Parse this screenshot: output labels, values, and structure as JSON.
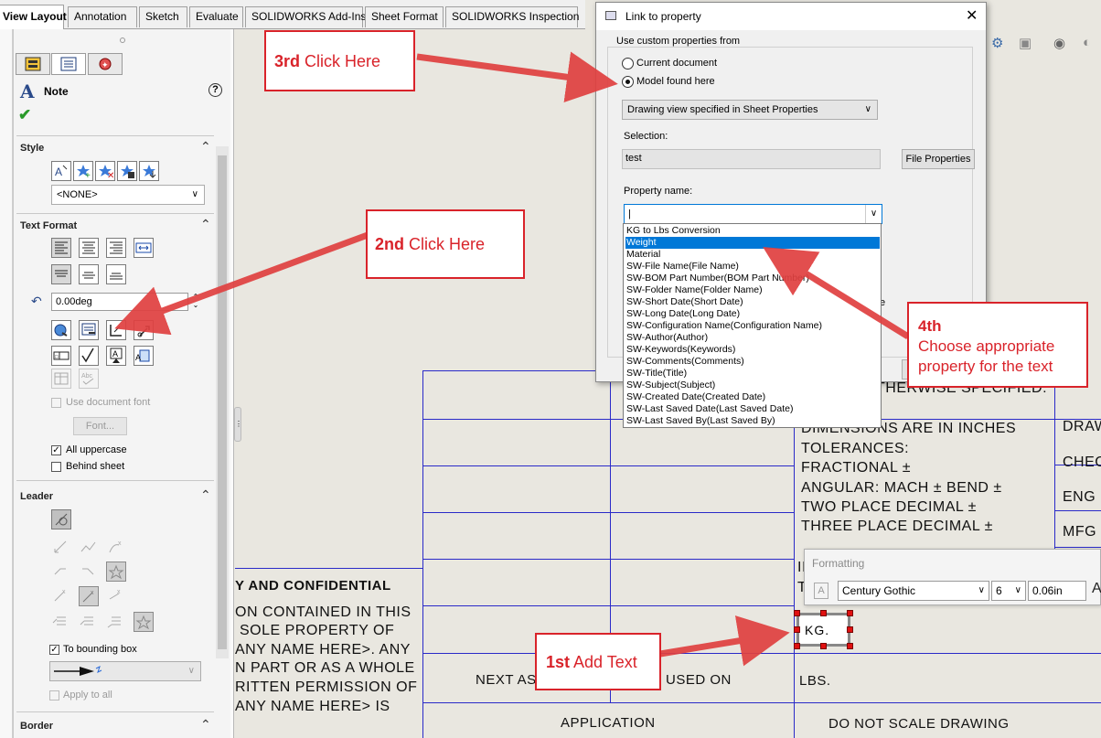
{
  "tabs": [
    "View Layout",
    "Annotation",
    "Sketch",
    "Evaluate",
    "SOLIDWORKS Add-Ins",
    "Sheet Format",
    "SOLIDWORKS Inspection"
  ],
  "property_manager": {
    "title": "Note",
    "sections": {
      "style": "Style",
      "text_format": "Text Format",
      "leader": "Leader",
      "border": "Border"
    },
    "style_value": "<NONE>",
    "angle_value": "0.00deg",
    "use_document_font": "Use document font",
    "font_button": "Font...",
    "all_uppercase": "All uppercase",
    "behind_sheet": "Behind sheet",
    "to_bounding_box": "To bounding box",
    "apply_to_all": "Apply to all",
    "abc_label": "Abc"
  },
  "dialog": {
    "title": "Link to property",
    "group_label": "Use custom properties from",
    "radio_current": "Current document",
    "radio_model": "Model found here",
    "model_source": "Drawing view specified in Sheet Properties",
    "selection_label": "Selection:",
    "selection_value": "test",
    "file_properties_button": "File Properties",
    "property_name_label": "Property name:",
    "property_name_value": "|",
    "partial_text": "e",
    "property_options": [
      "KG to Lbs Conversion",
      "Weight",
      "Material",
      "SW-File Name(File Name)",
      "SW-BOM Part Number(BOM Part Number)",
      "SW-Folder Name(Folder Name)",
      "SW-Short Date(Short Date)",
      "SW-Long Date(Long Date)",
      "SW-Configuration Name(Configuration Name)",
      "SW-Author(Author)",
      "SW-Keywords(Keywords)",
      "SW-Comments(Comments)",
      "SW-Title(Title)",
      "SW-Subject(Subject)",
      "SW-Created Date(Created Date)",
      "SW-Last Saved Date(Last Saved Date)",
      "SW-Last Saved By(Last Saved By)"
    ]
  },
  "drawing": {
    "confidential_title": "Y AND CONFIDENTIAL",
    "confidential_lines": [
      "ON CONTAINED IN THIS",
      "SOLE PROPERTY OF",
      "ANY NAME HERE>.  ANY",
      "N PART OR AS A WHOLE",
      "RITTEN PERMISSION OF",
      "ANY NAME HERE> IS"
    ],
    "next_assy": "NEXT ASS",
    "used_on": "USED ON",
    "application": "APPLICATION",
    "lbs": "LBS.",
    "do_not_scale": "DO NOT SCALE DRAWING",
    "otherwise": "THERWISE SPECIFIED:",
    "tolerances": [
      "DIMENSIONS ARE IN INCHES",
      "TOLERANCES:",
      "FRACTIONAL ±",
      "ANGULAR: MACH ±     BEND ±",
      "TWO PLACE DECIMAL     ±",
      "THREE PLACE DECIMAL    ±"
    ],
    "cut_ii": "II",
    "cut_t": "T",
    "right_col": [
      "DRAW",
      "CHEC",
      "ENG",
      "MFG"
    ],
    "note_text": "KG."
  },
  "formatting": {
    "title": "Formatting",
    "font": "Century Gothic",
    "size": "6",
    "height": "0.06in"
  },
  "callouts": {
    "c3_num": "3rd",
    "c3_text": " Click Here",
    "c2_num": "2nd",
    "c2_text": " Click Here",
    "c1_num": "1st",
    "c1_text": " Add Text",
    "c4_num": "4th",
    "c4_line1": "Choose appropriate",
    "c4_line2": "property for the text"
  },
  "colors": {
    "callout_red": "#d9232a",
    "drawing_blue": "#2a2ac8",
    "highlight": "#0078d7"
  }
}
